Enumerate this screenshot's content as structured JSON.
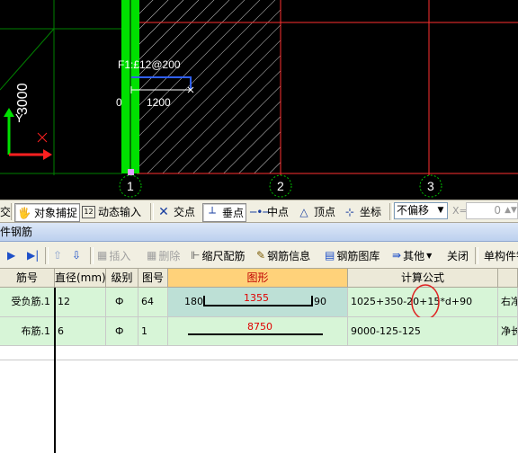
{
  "cad": {
    "axis_labels": [
      "1",
      "2",
      "3"
    ],
    "dim_vertical": "3000",
    "rebar_label": "F1:£12@200",
    "dim_zero": "0",
    "dim_length": "1200",
    "ucs_y": "Y",
    "colors": {
      "background": "#000000",
      "green": "#00e000",
      "red_grid": "#ff3030",
      "axis_circle": "#00c000"
    }
  },
  "snap_toolbar": {
    "items": [
      {
        "label": "交",
        "icon": "cut-icon"
      },
      {
        "label": "对象捕捉",
        "icon": "snap-icon",
        "pressed": true
      },
      {
        "label": "动态输入",
        "icon": "dynamic-input-icon"
      },
      {
        "label": "交点",
        "icon": "intersection-icon",
        "pressed": true
      },
      {
        "label": "垂点",
        "icon": "perpendicular-icon",
        "pressed": true
      },
      {
        "label": "中点",
        "icon": "midpoint-icon"
      },
      {
        "label": "顶点",
        "icon": "vertex-icon"
      },
      {
        "label": "坐标",
        "icon": "coordinate-icon"
      }
    ],
    "offset_select": "不偏移",
    "x_label": "X=",
    "x_value": "0"
  },
  "panel": {
    "title": "件钢筋"
  },
  "grid_toolbar": {
    "insert": "插入",
    "delete": "删除",
    "scale_rebar": "缩尺配筋",
    "rebar_info": "钢筋信息",
    "rebar_library": "钢筋图库",
    "other": "其他",
    "close": "关闭",
    "single_component": "单构件钢"
  },
  "table": {
    "headers": [
      "筋号",
      "直径(mm)",
      "级别",
      "图号",
      "图形",
      "计算公式",
      ""
    ],
    "rows": [
      {
        "name": "受负筋.1",
        "diameter": "12",
        "grade": "Ф",
        "fig": "64",
        "shape_left": "180",
        "shape_mid": "1355",
        "shape_right": "90",
        "formula": "1025+350-20+15*d+90",
        "desc": "右净"
      },
      {
        "name": "布筋.1",
        "diameter": "6",
        "grade": "Ф",
        "fig": "1",
        "shape_mid": "8750",
        "formula": "9000-125-125",
        "desc": "净长"
      }
    ]
  }
}
